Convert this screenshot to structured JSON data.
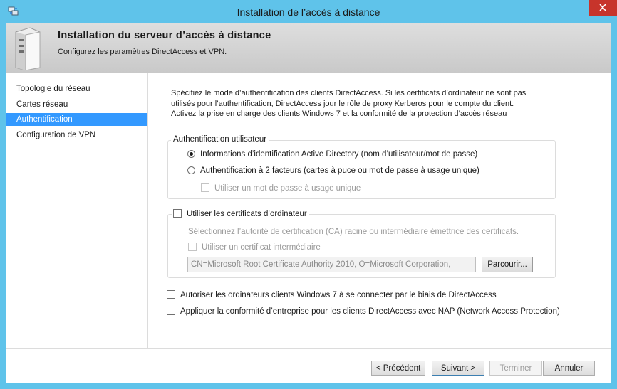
{
  "window": {
    "title": "Installation de l’accès à distance"
  },
  "banner": {
    "title": "Installation du serveur d’accès à distance",
    "subtitle": "Configurez les paramètres DirectAccess et VPN.",
    "icon": "server-icon"
  },
  "nav": {
    "items": [
      {
        "label": "Topologie du réseau",
        "selected": false
      },
      {
        "label": "Cartes réseau",
        "selected": false
      },
      {
        "label": "Authentification",
        "selected": true
      },
      {
        "label": "Configuration de VPN",
        "selected": false
      }
    ]
  },
  "main": {
    "intro_lines": [
      "Spécifiez le mode d’authentification des clients DirectAccess. Si les certificats d’ordinateur ne sont pas",
      "utilisés pour l’authentification, DirectAccess jour le rôle de proxy Kerberos pour le compte du client.",
      "Activez la prise en charge des clients Windows 7 et la conformité de la protection d’accès réseau"
    ],
    "user_auth": {
      "legend": "Authentification utilisateur",
      "radio_ad": "Informations d’identification Active Directory (nom d’utilisateur/mot de passe)",
      "radio_2fa": "Authentification à 2 facteurs (cartes à puce ou mot de passe à usage unique)",
      "otp_check": "Utiliser un mot de passe à usage unique",
      "selected": "ad"
    },
    "certs": {
      "legend_check": "Utiliser les certificats d’ordinateur",
      "ca_hint": "Sélectionnez l’autorité de certification (CA) racine ou intermédiaire émettrice des certificats.",
      "intermediate_check": "Utiliser un certificat intermédiaire",
      "ca_value": "CN=Microsoft Root Certificate Authority 2010, O=Microsoft Corporation,",
      "browse_label": "Parcourir..."
    },
    "win7_check": "Autoriser les ordinateurs clients Windows 7 à se connecter par le biais de DirectAccess",
    "nap_check": "Appliquer la conformité d’entreprise pour les clients DirectAccess avec NAP (Network Access Protection)"
  },
  "footer": {
    "prev_label": "< Précédent",
    "next_label": "Suivant >",
    "finish_label": "Terminer",
    "cancel_label": "Annuler"
  },
  "colors": {
    "title_bar": "#5fc3ea",
    "close_button": "#c7342b",
    "selection": "#3399ff"
  }
}
